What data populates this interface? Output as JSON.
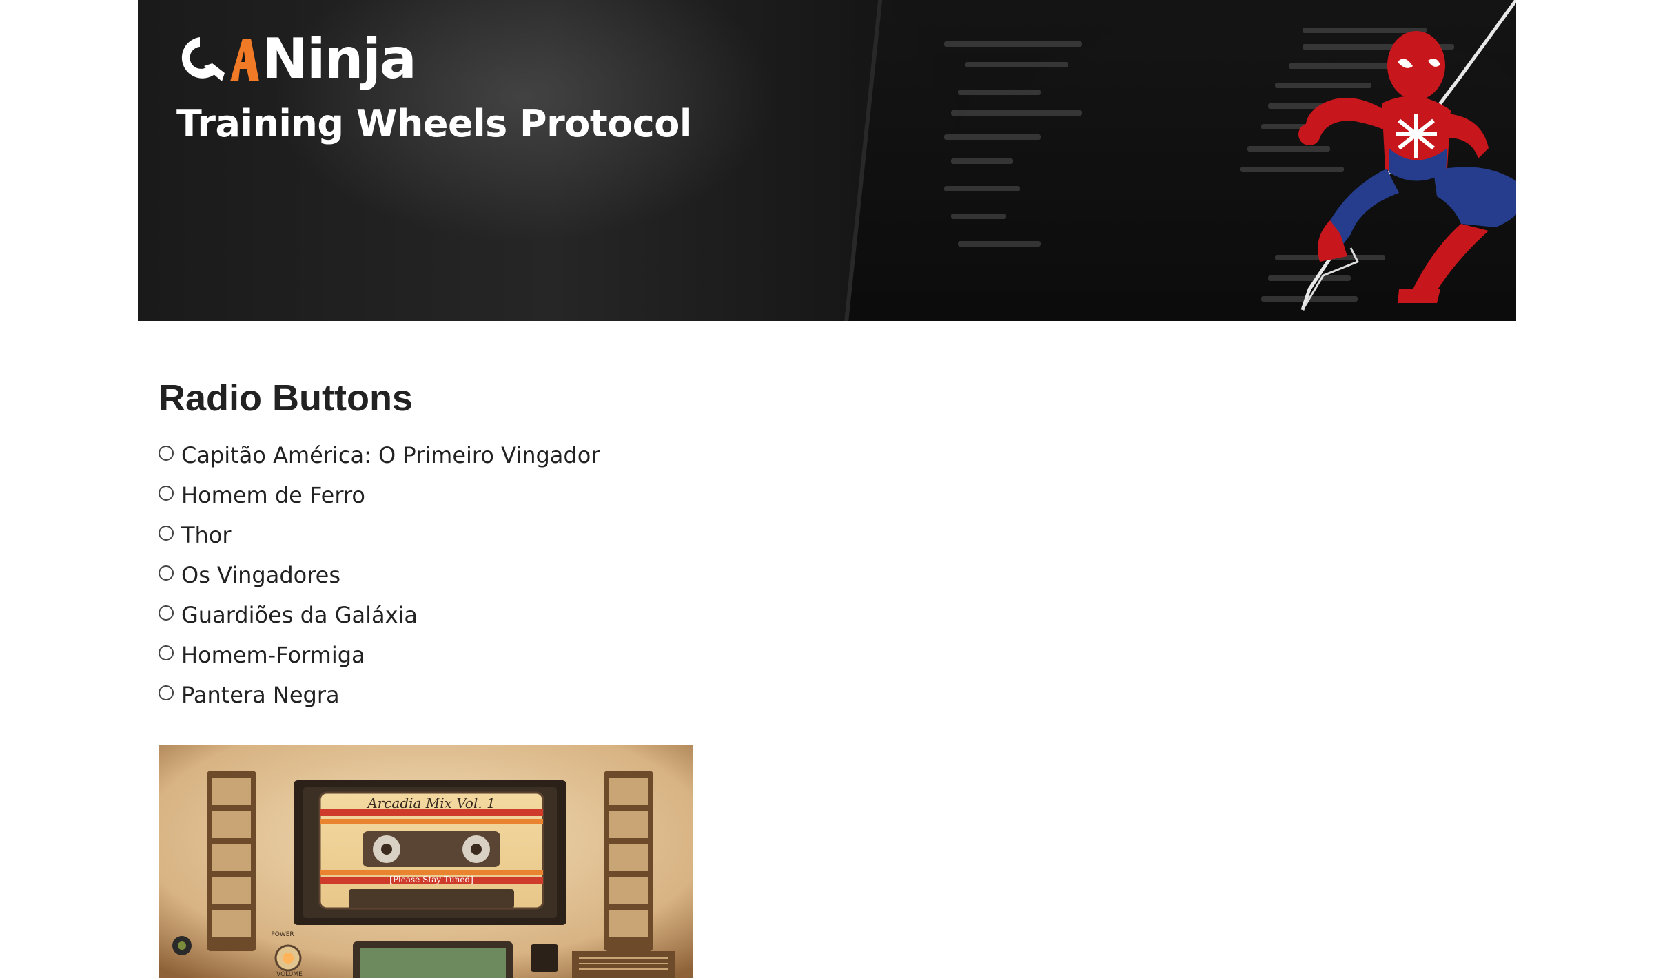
{
  "header": {
    "logo_text": "Ninja",
    "logo_mark": "QA",
    "subtitle": "Training Wheels Protocol",
    "hero_icon": "spiderman-figure",
    "colors": {
      "background": "#161616",
      "logo_accent": "#f07a26",
      "text": "#ffffff"
    }
  },
  "main": {
    "title": "Radio Buttons",
    "options": [
      {
        "label": "Capitão América: O Primeiro Vingador",
        "checked": false
      },
      {
        "label": "Homem de Ferro",
        "checked": false
      },
      {
        "label": "Thor",
        "checked": false
      },
      {
        "label": "Os Vingadores",
        "checked": false
      },
      {
        "label": "Guardiões da Galáxia",
        "checked": false
      },
      {
        "label": "Homem-Formiga",
        "checked": false
      },
      {
        "label": "Pantera Negra",
        "checked": false
      }
    ]
  },
  "image": {
    "tape_title": "Arcadia Mix Vol. 1",
    "tape_subtitle": "[Please Stay Tuned]",
    "power_label": "POWER",
    "volume_label": "VOLUME"
  }
}
